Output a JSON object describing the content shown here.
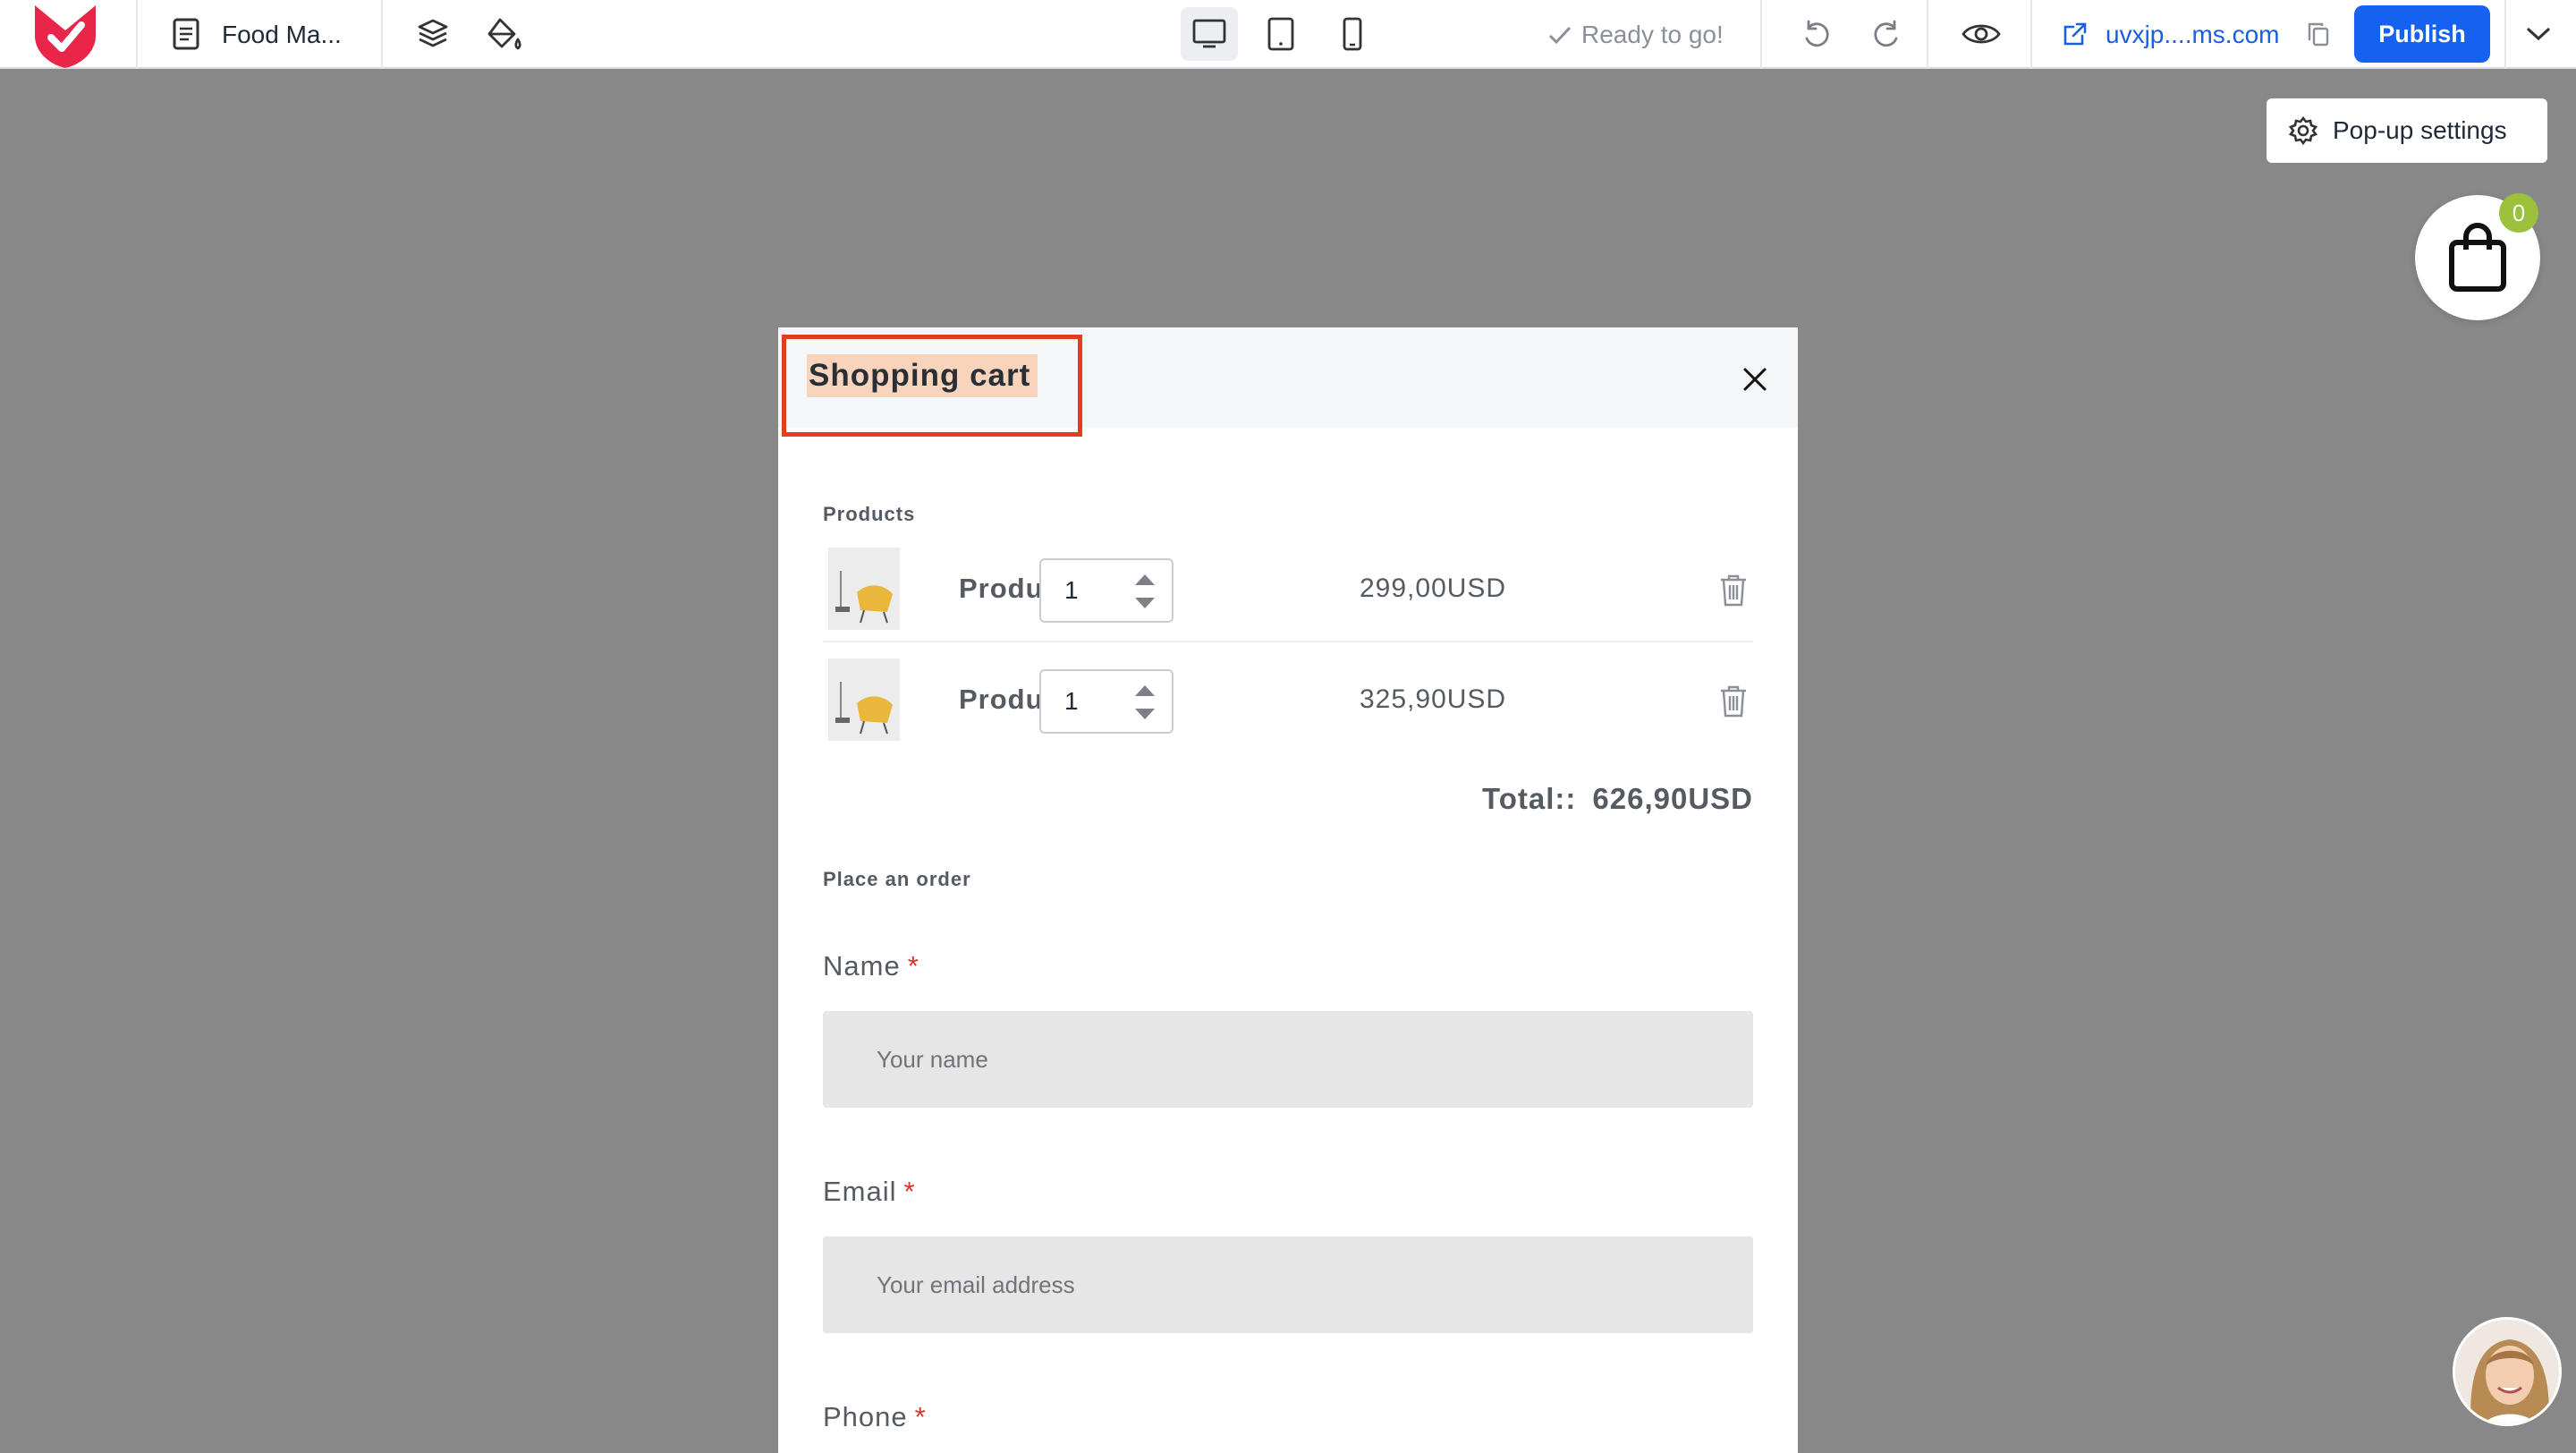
{
  "toolbar": {
    "page_name": "Food Ma...",
    "status": "Ready to go!",
    "site_url": "uvxjp....ms.com",
    "publish_label": "Publish",
    "active_device": "desktop",
    "accent_color": "#1662f0",
    "icons": [
      "logo-icon",
      "page-icon",
      "layers-icon",
      "paint-bucket-icon",
      "desktop-icon",
      "tablet-icon",
      "mobile-icon",
      "check-icon",
      "undo-icon",
      "redo-icon",
      "eye-icon",
      "external-link-icon",
      "copy-icon",
      "chevron-down-icon"
    ]
  },
  "popup_settings": {
    "label": "Pop-up settings",
    "icon": "gear-icon"
  },
  "cart_widget": {
    "count": "0",
    "icon": "shopping-bag-icon",
    "badge_color": "#9bc03c"
  },
  "modal": {
    "title": "Shopping cart",
    "products_label": "Products",
    "items": [
      {
        "name": "Product n...",
        "quantity": "1",
        "price": "299,00USD"
      },
      {
        "name": "Product n...",
        "quantity": "1",
        "price": "325,90USD"
      }
    ],
    "total_label": "Total::",
    "total_value": "626,90USD",
    "order_label": "Place an order",
    "fields": {
      "name": {
        "label": "Name",
        "required": "*",
        "placeholder": "Your name"
      },
      "email": {
        "label": "Email",
        "required": "*",
        "placeholder": "Your email address"
      },
      "phone": {
        "label": "Phone",
        "required": "*"
      }
    },
    "highlight_color": "#e43b23"
  }
}
